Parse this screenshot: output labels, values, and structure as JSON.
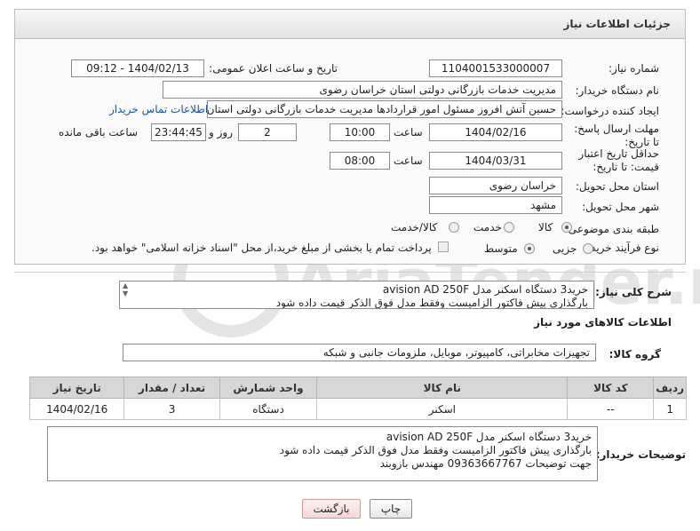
{
  "header": {
    "title": "جزئیات اطلاعات نیاز"
  },
  "fields": {
    "need_number_label": "شماره نیاز:",
    "need_number": "1104001533000007",
    "announce_label": "تاریخ و ساعت اعلان عمومی:",
    "announce_value": "1404/02/13 - 09:12",
    "buyer_org_label": "نام دستگاه خریدار:",
    "buyer_org": "مدیریت خدمات بازرگانی دولتی استان خراسان رضوی",
    "creator_label": "ایجاد کننده درخواست:",
    "creator": "حسین آتش افروز مسئول امور قراردادها مدیریت خدمات بازرگانی دولتی استان خراسان رضوی",
    "contact_link": "اطلاعات تماس خریدار",
    "deadline_label": "مهلت ارسال پاسخ: تا تاریخ:",
    "deadline_date": "1404/02/16",
    "time_label": "ساعت",
    "deadline_time": "10:00",
    "days_value": "2",
    "days_label": "روز و",
    "remaining_time": "23:44:45",
    "remaining_label": "ساعت باقی مانده",
    "validity_label": "حداقل تاریخ اعتبار قیمت: تا تاریخ:",
    "validity_date": "1404/03/31",
    "validity_time_label": "ساعت",
    "validity_time": "08:00",
    "province_label": "استان محل تحویل:",
    "province": "خراسان رضوی",
    "city_label": "شهر محل تحویل:",
    "city": "مشهد",
    "category_label": "طبقه بندی موضوعی:",
    "category_options": [
      "کالا",
      "خدمت",
      "کالا/خدمت"
    ],
    "process_label": "نوع فرآیند خرید :",
    "process_options": [
      "جزیی",
      "متوسط"
    ],
    "payment_note": "پرداخت تمام یا بخشی از مبلغ خرید،از محل \"اسناد خزانه اسلامی\" خواهد بود."
  },
  "description": {
    "label": "شرح کلی نیاز:",
    "text": "خرید3 دستگاه اسکنر مدل avision AD 250F\nبارگذاری پیش فاکتور الزامیست وفقط مدل فوق الذکر قیمت داده شود"
  },
  "goods_section": {
    "title": "اطلاعات کالاهای مورد نیاز",
    "group_label": "گروه کالا:",
    "group_value": "تجهیزات مخابراتی، کامپیوتر، موبایل، ملزومات جانبی و شبکه"
  },
  "table": {
    "headers": [
      "ردیف",
      "کد کالا",
      "نام کالا",
      "واحد شمارش",
      "تعداد / مقدار",
      "تاریخ نیاز"
    ],
    "rows": [
      [
        "1",
        "--",
        "اسکنر",
        "دستگاه",
        "3",
        "1404/02/16"
      ]
    ]
  },
  "buyer_notes": {
    "label": "توضیحات خریدار:",
    "text": "خرید3 دستگاه اسکنر مدل avision AD 250F\nبارگذاری پیش فاکتور الزامیست وفقط مدل فوق الذکر قیمت داده شود\nجهت توضیحات 09363667767 مهندس بازوبند"
  },
  "buttons": {
    "print": "چاپ",
    "back": "بازگشت"
  },
  "watermark_text": "AriaTender.neT"
}
